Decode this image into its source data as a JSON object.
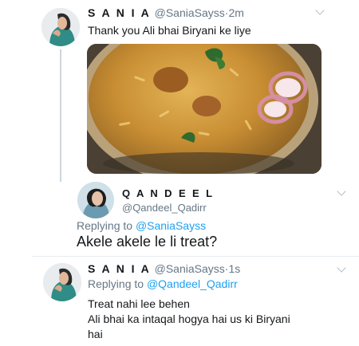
{
  "tweets": [
    {
      "display_name": "S A N I A",
      "handle": "@SaniaSayss",
      "separator": "·",
      "time": "2m",
      "text": "Thank you Ali bhai Biryani ke liye",
      "media_alt": "plate of biryani with onion rings"
    },
    {
      "display_name": "Q A N D E E L",
      "handle": "@Qandeel_Qadirr",
      "replying_prefix": "Replying to",
      "replying_to": "@SaniaSayss",
      "text": "Akele akele le li treat?"
    },
    {
      "display_name": "S A N I A",
      "handle": "@SaniaSayss",
      "separator": "·",
      "time": "1s",
      "replying_prefix": "Replying to",
      "replying_to": "@Qandeel_Qadirr",
      "lines": [
        "Treat nahi lee behen",
        "Ali bhai ka intaqal hogya hai us ki Biryani",
        "hai"
      ]
    }
  ],
  "colors": {
    "link": "#1da1f2",
    "muted": "#657786",
    "text": "#14171a"
  },
  "icons": [
    "chevron-down-icon"
  ]
}
